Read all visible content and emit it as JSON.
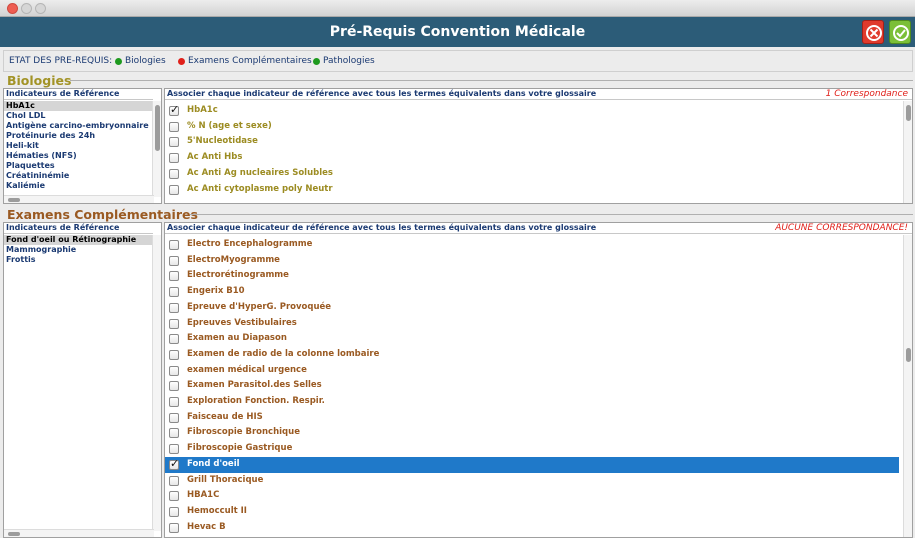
{
  "window": {
    "title": "Pré-Requis Convention Médicale",
    "buttons": {
      "cancel_icon": "cancel-icon",
      "confirm_icon": "confirm-icon"
    }
  },
  "status": {
    "label": "ETAT DES PRE-REQUIS:",
    "items": [
      {
        "label": "Biologies",
        "color": "#1e9a1e"
      },
      {
        "label": "Examens Complémentaires",
        "color": "#e0201a"
      },
      {
        "label": "Pathologies",
        "color": "#1e9a1e"
      }
    ]
  },
  "biologies": {
    "title": "Biologies",
    "title_color": "#a29326",
    "indicators_header": "Indicateurs de Référence",
    "indicators": [
      "HbA1c",
      "Chol LDL",
      "Antigène carcino-embryonnaire (AC",
      "Protéinurie des 24h",
      "Heli-kit",
      "Hématies (NFS)",
      "Plaquettes",
      "Créatininémie",
      "Kaliémie"
    ],
    "selected_indicator": 0,
    "terms_header": "Associer chaque indicateur de référence avec tous les termes équivalents dans votre glossaire",
    "match_note": "1 Correspondance",
    "terms": [
      {
        "label": "HbA1c",
        "checked": true
      },
      {
        "label": "% N (age et sexe)",
        "checked": false
      },
      {
        "label": "5'Nucleotidase",
        "checked": false
      },
      {
        "label": "Ac Anti  Hbs",
        "checked": false
      },
      {
        "label": "Ac Anti Ag nucleaires Solubles",
        "checked": false
      },
      {
        "label": "Ac Anti cytoplasme poly Neutr",
        "checked": false
      }
    ]
  },
  "examens": {
    "title": "Examens Complémentaires",
    "title_color": "#9a5a22",
    "indicators_header": "Indicateurs de Référence",
    "indicators": [
      "Fond d'oeil ou Rétinographie",
      "Mammographie",
      "Frottis"
    ],
    "selected_indicator": 0,
    "terms_header": "Associer chaque indicateur de référence avec tous les termes équivalents dans votre glossaire",
    "match_note": "AUCUNE CORRESPONDANCE!",
    "terms": [
      {
        "label": "Electro Encephalogramme",
        "checked": false
      },
      {
        "label": "ElectroMyogramme",
        "checked": false
      },
      {
        "label": "Electrorétinogramme",
        "checked": false
      },
      {
        "label": "Engerix B10",
        "checked": false
      },
      {
        "label": "Epreuve d'HyperG. Provoquée",
        "checked": false
      },
      {
        "label": "Epreuves Vestibulaires",
        "checked": false
      },
      {
        "label": "Examen au Diapason",
        "checked": false
      },
      {
        "label": "Examen de radio de la colonne lombaire",
        "checked": false
      },
      {
        "label": "examen médical urgence",
        "checked": false
      },
      {
        "label": "Examen Parasitol.des Selles",
        "checked": false
      },
      {
        "label": "Exploration Fonction. Respir.",
        "checked": false
      },
      {
        "label": "Faisceau de HIS",
        "checked": false
      },
      {
        "label": "Fibroscopie Bronchique",
        "checked": false
      },
      {
        "label": "Fibroscopie Gastrique",
        "checked": false
      },
      {
        "label": "Fond d'oeil",
        "checked": true,
        "selected": true
      },
      {
        "label": "Grill Thoracique",
        "checked": false
      },
      {
        "label": "HBA1C",
        "checked": false
      },
      {
        "label": "Hemoccult II",
        "checked": false
      },
      {
        "label": "Hevac B",
        "checked": false
      }
    ]
  }
}
